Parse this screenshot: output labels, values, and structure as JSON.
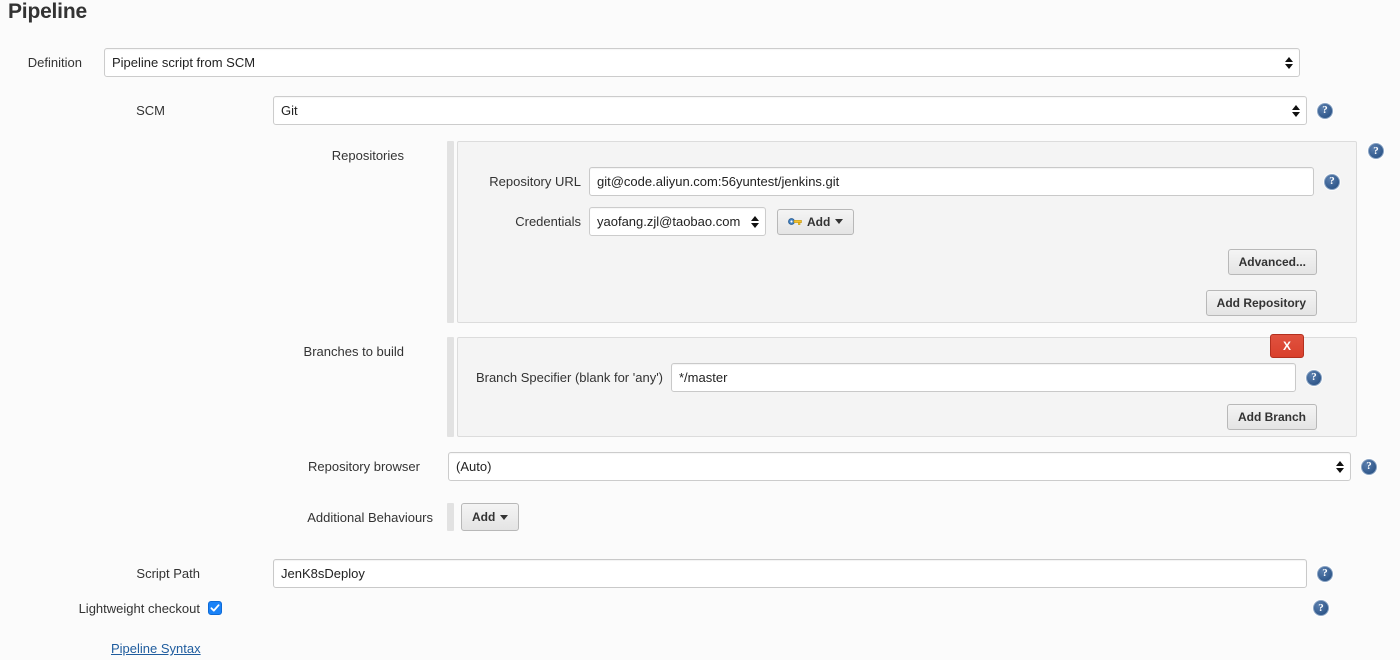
{
  "page": {
    "title": "Pipeline"
  },
  "definition": {
    "label": "Definition",
    "value": "Pipeline script from SCM"
  },
  "scm": {
    "label": "SCM",
    "value": "Git",
    "help": "?"
  },
  "repositories": {
    "label": "Repositories",
    "help": "?",
    "repository_url": {
      "label": "Repository URL",
      "value": "git@code.aliyun.com:56yuntest/jenkins.git",
      "help": "?"
    },
    "credentials": {
      "label": "Credentials",
      "value": "yaofang.zjl@taobao.com",
      "add_label": "Add",
      "add_icon": "key-icon"
    },
    "advanced_label": "Advanced...",
    "add_repository_label": "Add Repository"
  },
  "branches": {
    "label": "Branches to build",
    "help": "?",
    "delete_label": "X",
    "branch_specifier": {
      "label": "Branch Specifier (blank for 'any')",
      "value": "*/master",
      "help": "?"
    },
    "add_branch_label": "Add Branch"
  },
  "repository_browser": {
    "label": "Repository browser",
    "value": "(Auto)",
    "help": "?"
  },
  "additional_behaviours": {
    "label": "Additional Behaviours",
    "add_label": "Add"
  },
  "script_path": {
    "label": "Script Path",
    "value": "JenK8sDeploy",
    "help": "?"
  },
  "lightweight_checkout": {
    "label": "Lightweight checkout",
    "checked": true,
    "help": "?"
  },
  "pipeline_syntax": {
    "label": "Pipeline Syntax"
  },
  "colors": {
    "accent_blue": "#1f5c9e",
    "help_blue": "#31598c",
    "danger_red": "#d9402c",
    "checkbox_blue": "#1a82f7",
    "page_bg": "#fbfbfb",
    "panel_bg": "#f4f4f4"
  }
}
